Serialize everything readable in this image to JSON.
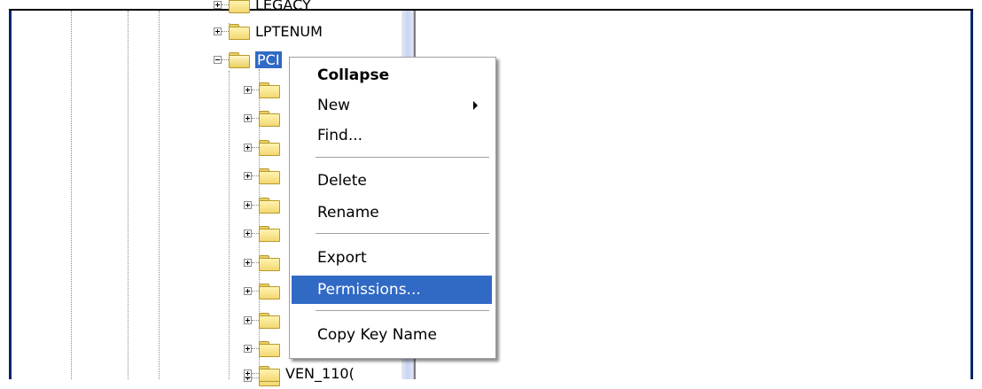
{
  "tree": {
    "top_label": "LEGACY",
    "nodes": [
      {
        "label": "LPTENUM",
        "expanded": false
      },
      {
        "label": "PCI",
        "expanded": true,
        "selected": true
      }
    ],
    "children_count_visible": 11,
    "bottom_label": "VEN_110("
  },
  "context_menu": {
    "items": [
      {
        "label": "Collapse",
        "bold": true
      },
      {
        "label": "New",
        "submenu": true
      },
      {
        "label": "Find..."
      },
      {
        "separator": true
      },
      {
        "label": "Delete"
      },
      {
        "label": "Rename"
      },
      {
        "separator": true
      },
      {
        "label": "Export"
      },
      {
        "label": "Permissions...",
        "highlighted": true
      },
      {
        "separator": true
      },
      {
        "label": "Copy Key Name"
      }
    ]
  },
  "colors": {
    "selection": "#316ac5",
    "window_border": "#0a246a",
    "folder_fill": "#f3d873"
  },
  "icons": [
    "folder-icon",
    "expand-plus-icon",
    "collapse-minus-icon",
    "submenu-arrow-icon"
  ]
}
